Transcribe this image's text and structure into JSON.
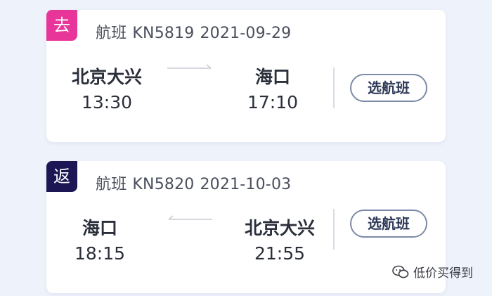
{
  "outbound": {
    "badge": "去",
    "badge_color": "#e8359a",
    "flight_label": "航班",
    "flight_number": "KN5819",
    "date": "2021-09-29",
    "from_city": "北京大兴",
    "from_time": "13:30",
    "to_city": "海口",
    "to_time": "17:10",
    "button_label": "选航班"
  },
  "return": {
    "badge": "返",
    "badge_color": "#1c1654",
    "flight_label": "航班",
    "flight_number": "KN5820",
    "date": "2021-10-03",
    "from_city": "海口",
    "from_time": "18:15",
    "to_city": "北京大兴",
    "to_time": "21:55",
    "button_label": "选航班"
  },
  "watermark": {
    "icon": "wechat-icon",
    "text": "低价买得到"
  }
}
